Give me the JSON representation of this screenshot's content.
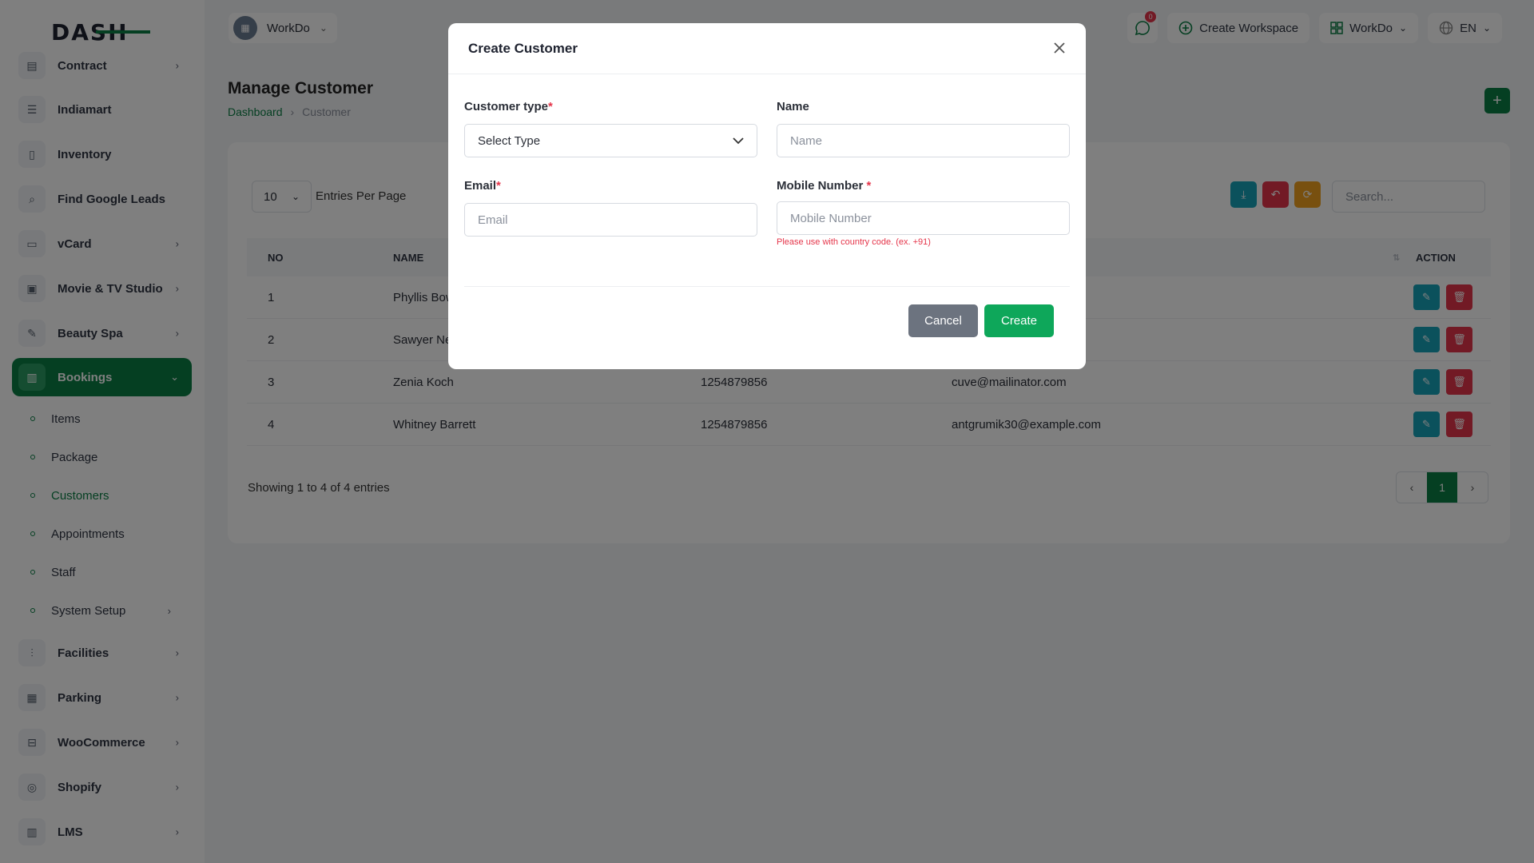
{
  "logo": {
    "text": "DASH"
  },
  "sidebar": {
    "items": [
      {
        "label": "Contract",
        "chevron": true
      },
      {
        "label": "Indiamart",
        "chevron": false
      },
      {
        "label": "Inventory",
        "chevron": false
      },
      {
        "label": "Find Google Leads",
        "chevron": false
      },
      {
        "label": "vCard",
        "chevron": true
      },
      {
        "label": "Movie & TV Studio",
        "chevron": true
      },
      {
        "label": "Beauty Spa",
        "chevron": true
      },
      {
        "label": "Bookings",
        "chevron": true
      }
    ],
    "subitems": [
      {
        "label": "Items"
      },
      {
        "label": "Package"
      },
      {
        "label": "Customers"
      },
      {
        "label": "Appointments"
      },
      {
        "label": "Staff"
      },
      {
        "label": "System Setup"
      }
    ],
    "bottom_items": [
      {
        "label": "Facilities"
      },
      {
        "label": "Parking"
      },
      {
        "label": "WooCommerce"
      },
      {
        "label": "Shopify"
      },
      {
        "label": "LMS"
      }
    ]
  },
  "topbar": {
    "workspace": "WorkDo",
    "message_count": "0",
    "create_workspace": "Create Workspace",
    "workspace_menu": "WorkDo",
    "language": "EN"
  },
  "page": {
    "title": "Manage Customer",
    "breadcrumb_home": "Dashboard",
    "breadcrumb_current": "Customer"
  },
  "list": {
    "per_page_value": "10",
    "per_page_label": "Entries Per Page",
    "search_placeholder": "Search...",
    "headers": {
      "no": "NO",
      "name": "NAME",
      "action": "ACTION"
    },
    "rows": [
      {
        "no": "1",
        "name": "Phyllis Bow",
        "mobile": "",
        "email": ""
      },
      {
        "no": "2",
        "name": "Sawyer Ne",
        "mobile": "",
        "email": ""
      },
      {
        "no": "3",
        "name": "Zenia Koch",
        "mobile": "1254879856",
        "email": "cuve@mailinator.com"
      },
      {
        "no": "4",
        "name": "Whitney Barrett",
        "mobile": "1254879856",
        "email": "antgrumik30@example.com"
      }
    ],
    "showing": "Showing 1 to 4 of 4 entries",
    "current_page": "1"
  },
  "modal": {
    "title": "Create Customer",
    "customer_type_label": "Customer type",
    "customer_type_value": "Select Type",
    "name_label": "Name",
    "name_placeholder": "Name",
    "email_label": "Email",
    "email_placeholder": "Email",
    "mobile_label": "Mobile Number ",
    "mobile_placeholder": "Mobile Number",
    "mobile_hint": "Please use with country code. (ex. +91)",
    "required_mark": "*",
    "cancel": "Cancel",
    "create": "Create"
  },
  "colors": {
    "primary": "#0b7f45",
    "danger": "#e5354a",
    "info": "#17a2b8",
    "warning": "#f0a01e",
    "create_button": "#0ea75a",
    "cancel_button": "#6c737f"
  }
}
